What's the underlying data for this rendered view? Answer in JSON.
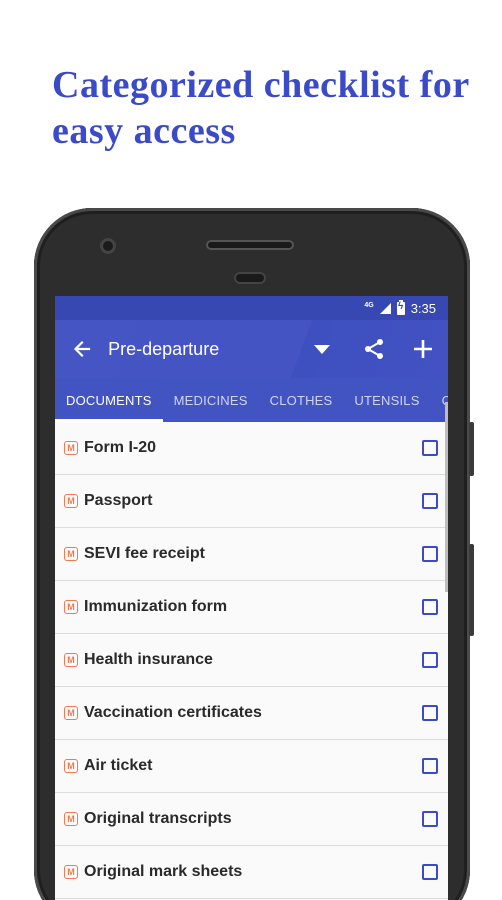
{
  "headline": "Categorized checklist for easy access",
  "status_bar": {
    "network": "4G",
    "time": "3:35"
  },
  "app_bar": {
    "title": "Pre-departure",
    "back_icon": "arrow-left-icon",
    "dropdown_icon": "triangle-down-icon",
    "share_icon": "share-icon",
    "add_icon": "plus-icon"
  },
  "tabs": [
    {
      "label": "DOCUMENTS",
      "active": true
    },
    {
      "label": "MEDICINES",
      "active": false
    },
    {
      "label": "CLOTHES",
      "active": false
    },
    {
      "label": "UTENSILS",
      "active": false
    },
    {
      "label": "COOKWARE",
      "active": false
    }
  ],
  "badge_letter": "M",
  "items": [
    {
      "label": "Form I-20",
      "checked": false
    },
    {
      "label": "Passport",
      "checked": false
    },
    {
      "label": "SEVI fee receipt",
      "checked": false
    },
    {
      "label": "Immunization form",
      "checked": false
    },
    {
      "label": "Health insurance",
      "checked": false
    },
    {
      "label": "Vaccination certificates",
      "checked": false
    },
    {
      "label": "Air ticket",
      "checked": false
    },
    {
      "label": "Original transcripts",
      "checked": false
    },
    {
      "label": "Original mark sheets",
      "checked": false
    }
  ],
  "colors": {
    "accent": "#3b4bc8",
    "app_bar": "#4454c2",
    "badge": "#f07a52"
  }
}
